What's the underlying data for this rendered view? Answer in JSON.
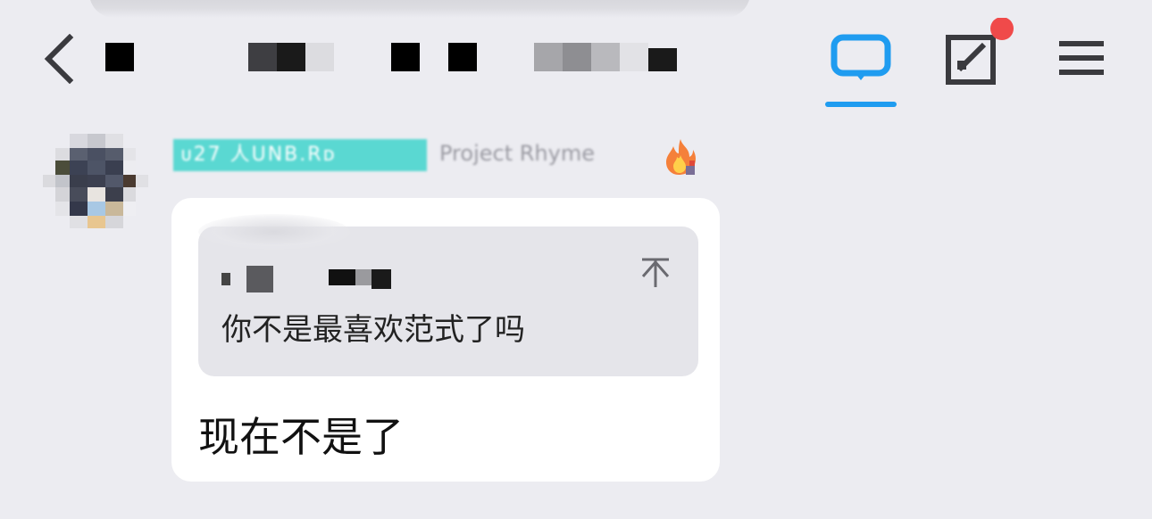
{
  "header": {
    "back_icon": "chevron-left-icon",
    "chat_icon": "chat-bubble-icon",
    "edit_icon": "edit-square-icon",
    "menu_icon": "hamburger-menu-icon",
    "accent_color": "#1f9cf0",
    "notification_color": "#f04a4a"
  },
  "message": {
    "sender_badge": "ᴜ27 人UNB.Rᴅ",
    "sender_subtitle": "Project Rhyme",
    "fire_icon": "fire-icon",
    "quote": {
      "text": "你不是最喜欢范式了吗",
      "jump_icon": "scroll-to-top-icon"
    },
    "reply_text": "现在不是了"
  }
}
